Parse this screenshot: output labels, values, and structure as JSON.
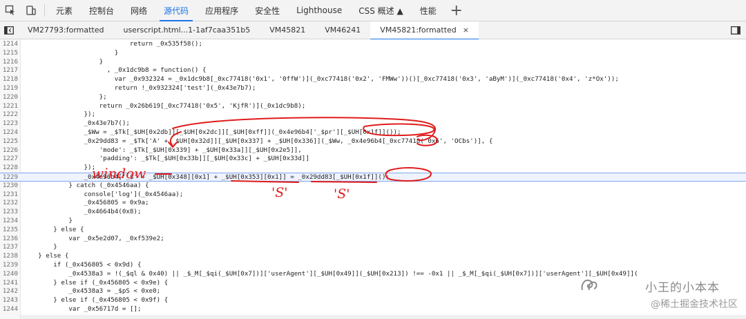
{
  "toolbar": {
    "tabs": [
      "元素",
      "控制台",
      "网络",
      "源代码",
      "应用程序",
      "安全性",
      "Lighthouse",
      "CSS 概述 ▲",
      "性能"
    ],
    "active_tab": "源代码",
    "icons": [
      "inspect-element-icon",
      "device-toolbar-icon",
      "add-panel-icon"
    ]
  },
  "filetabs": {
    "tabs": [
      "VM27793:formatted",
      "userscript.html...1-1af7caa351b5",
      "VM45821",
      "VM46241",
      "VM45821:formatted"
    ],
    "active_tab": "VM45821:formatted",
    "close_glyph": "×"
  },
  "editor": {
    "highlighted_line": "1229",
    "lines": [
      {
        "n": "1214",
        "t": "                            return _0x535f58();"
      },
      {
        "n": "1215",
        "t": "                        }"
      },
      {
        "n": "1216",
        "t": "                    }"
      },
      {
        "n": "1217",
        "t": "                      , _0x1dc9b8 = function() {"
      },
      {
        "n": "1218",
        "t": "                        var _0x932324 = _0x1dc9b8[_0xc77418('0x1', '0ffW')](_0xc77418('0x2', 'FMWw'))()[_0xc77418('0x3', 'aByM')](_0xc77418('0x4', 'z*Ox'));"
      },
      {
        "n": "1219",
        "t": "                        return !_0x932324['test'](_0x43e7b7);"
      },
      {
        "n": "1220",
        "t": "                    };"
      },
      {
        "n": "1221",
        "t": "                    return _0x26b619[_0xc77418('0x5', 'KjfR')](_0x1dc9b8);"
      },
      {
        "n": "1222",
        "t": "                });"
      },
      {
        "n": "1223",
        "t": "                _0x43e7b7();"
      },
      {
        "n": "1224",
        "t": "                _$Ww = _$Tk[_$UH[0x2db]][_$UH[0x2dc]][_$UH[0xff]](_0x4e96b4['_$pr'][_$UH[0x1f]]());"
      },
      {
        "n": "1225",
        "t": "                _0x29dd83 = _$Tk['A' + _$UH[0x32d]][_$UH[0x337] + _$UH[0x336]](_$Ww, _0x4e96b4[_0xc77418('0x6', 'OCbs')], {"
      },
      {
        "n": "1226",
        "t": "                    'mode': _$Tk[_$UH[0x339] + _$UH[0x33a]][_$UH[0x2e5]],"
      },
      {
        "n": "1227",
        "t": "                    'padding': _$Tk[_$UH[0x33b]][_$UH[0x33c] + _$UH[0x33d]]"
      },
      {
        "n": "1228",
        "t": "                });"
      },
      {
        "n": "1229",
        "t": "                _0x4e96b4['_$' + _$UH[0x348][0x1] + _$UH[0x353][0x1]] = _0x29dd83[_$UH[0x1f]]();"
      },
      {
        "n": "1230",
        "t": "            } catch (_0x4546aa) {"
      },
      {
        "n": "1231",
        "t": "                console['log'](_0x4546aa);"
      },
      {
        "n": "1232",
        "t": "                _0x456805 = 0x9a;"
      },
      {
        "n": "1233",
        "t": "                _0x4664b4(0x8);"
      },
      {
        "n": "1234",
        "t": "            }"
      },
      {
        "n": "1235",
        "t": "        } else {"
      },
      {
        "n": "1236",
        "t": "            var _0x5e2d07, _0xf539e2;"
      },
      {
        "n": "1237",
        "t": "        }"
      },
      {
        "n": "1238",
        "t": "    } else {"
      },
      {
        "n": "1239",
        "t": "        if (_0x456805 < 0x9d) {"
      },
      {
        "n": "1240",
        "t": "            _0x4538a3 = !(_$ql & 0x40) || _$_M[_$qi(_$UH[0x7])]['userAgent'][_$UH[0x49]](_$UH[0x213]) !== -0x1 || _$_M[_$qi(_$UH[0x7])]['userAgent'][_$UH[0x49]]("
      },
      {
        "n": "1241",
        "t": "        } else if (_0x456805 < 0x9e) {"
      },
      {
        "n": "1242",
        "t": "            _0x4538a3 = _$pS < 0xe0;"
      },
      {
        "n": "1243",
        "t": "        } else if (_0x456805 < 0x9f) {"
      },
      {
        "n": "1244",
        "t": "            var _0x56717d = [];"
      }
    ]
  },
  "annotations": {
    "window_label": "window",
    "s_label_1": "'S'",
    "s_label_2": "'S'"
  },
  "watermark": {
    "title": "小王的小本本",
    "subtitle": "@稀土掘金技术社区",
    "logo_icon": "wechat-channel-logo"
  },
  "colors": {
    "accent": "#1a73e8",
    "annotation": "#e01b1b",
    "highlight_line": "#eef3ff"
  }
}
